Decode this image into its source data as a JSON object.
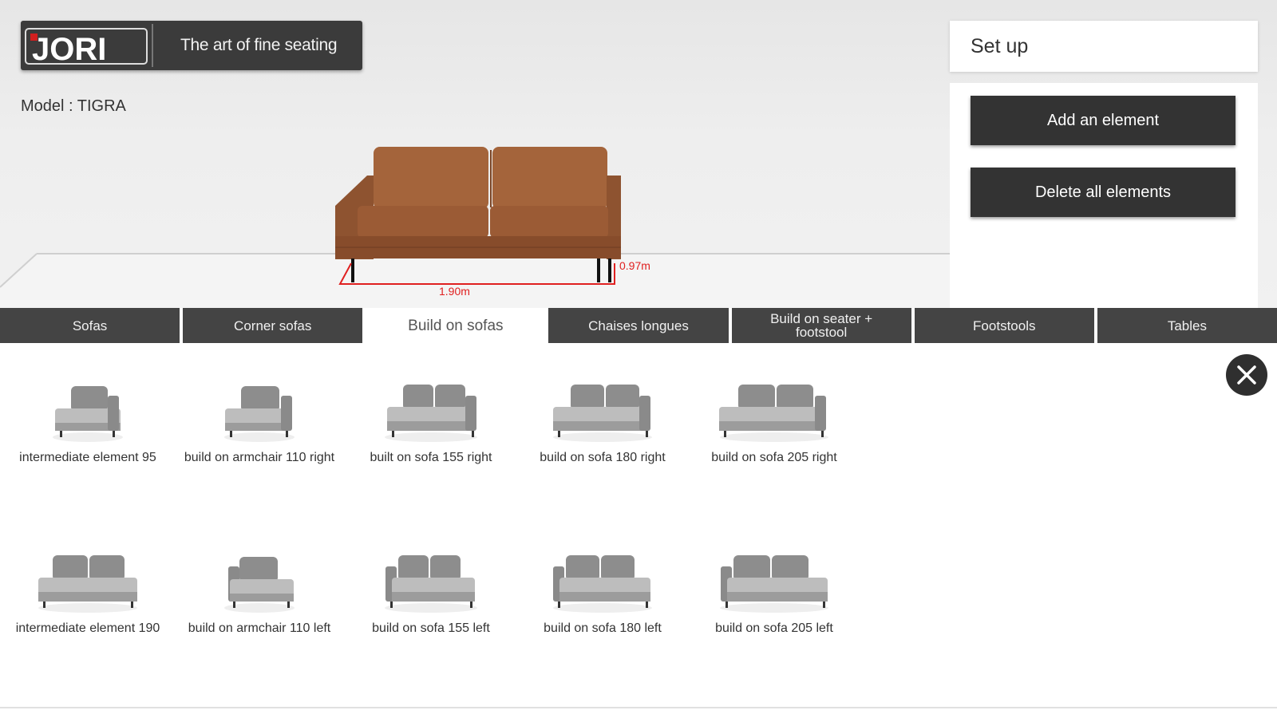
{
  "brand": {
    "logo_text": "JORI",
    "tagline": "The art of fine seating"
  },
  "model": {
    "label": "Model : TIGRA"
  },
  "viewport": {
    "depth_label": "0.97m",
    "width_label": "1.90m"
  },
  "setup": {
    "title": "Set up",
    "add_label": "Add an element",
    "delete_label": "Delete all elements"
  },
  "tabs": [
    {
      "label": "Sofas"
    },
    {
      "label": "Corner sofas"
    },
    {
      "label": "Build on sofas"
    },
    {
      "label": "Chaises longues"
    },
    {
      "label": "Build on seater + footstool"
    },
    {
      "label": "Footstools"
    },
    {
      "label": "Tables"
    }
  ],
  "active_tab": "Build on sofas",
  "catalog": [
    {
      "label": "intermediate element 95"
    },
    {
      "label": "build on armchair 110 right"
    },
    {
      "label": "built on sofa 155   right"
    },
    {
      "label": "build on sofa 180   right"
    },
    {
      "label": "build on sofa 205   right"
    },
    {
      "label": "intermediate element 190"
    },
    {
      "label": "build on armchair 110   left"
    },
    {
      "label": "build on sofa 155   left"
    },
    {
      "label": "build on sofa 180   left"
    },
    {
      "label": "build on sofa 205   left"
    }
  ],
  "icons": {
    "close": "close-icon"
  },
  "colors": {
    "dark": "#333333",
    "leather": "#9a5a34",
    "dimension": "#e02020"
  }
}
